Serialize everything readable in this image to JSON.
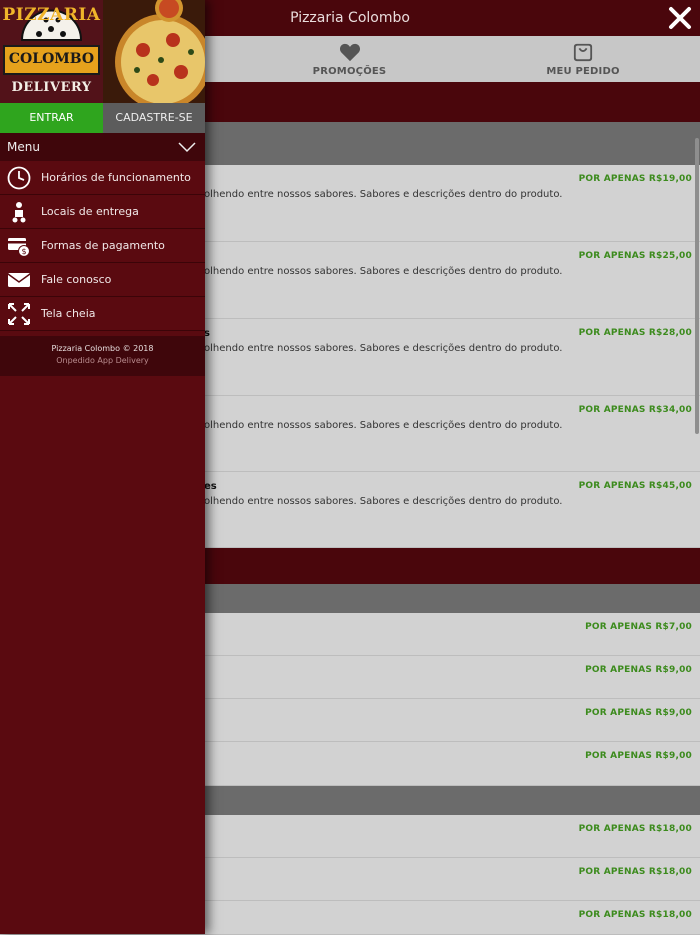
{
  "app": {
    "title": "Pizzaria Colombo"
  },
  "tabs": [
    {
      "label": "PROMOÇÕES",
      "icon": "heart-icon"
    },
    {
      "label": "MEU PEDIDO",
      "icon": "bag-icon"
    }
  ],
  "sections": [
    {
      "rows": [
        {
          "name": "",
          "desc": "olhendo entre nossos sabores. Sabores e descrições dentro do produto.",
          "price": "POR APENAS R$19,00"
        },
        {
          "name": "",
          "desc": "olhendo entre nossos sabores. Sabores e descrições dentro do produto.",
          "price": "POR APENAS R$25,00"
        },
        {
          "name": "s",
          "desc": "olhendo entre nossos sabores. Sabores e descrições dentro do produto.",
          "price": "POR APENAS R$28,00"
        },
        {
          "name": "",
          "desc": "olhendo entre nossos sabores. Sabores e descrições dentro do produto.",
          "price": "POR APENAS R$34,00"
        },
        {
          "name": "es",
          "desc": "olhendo entre nossos sabores. Sabores e descrições dentro do produto.",
          "price": "POR APENAS R$45,00"
        }
      ]
    },
    {
      "rows": [
        {
          "price": "POR APENAS R$7,00"
        },
        {
          "price": "POR APENAS R$9,00"
        },
        {
          "price": "POR APENAS R$9,00"
        },
        {
          "price": "POR APENAS R$9,00"
        }
      ]
    },
    {
      "rows": [
        {
          "price": "POR APENAS R$18,00"
        },
        {
          "price": "POR APENAS R$18,00"
        },
        {
          "price": "POR APENAS R$18,00"
        }
      ]
    }
  ],
  "drawer": {
    "logo": {
      "line1": "PIZZARIA",
      "line2": "COLOMBO",
      "line3": "DELIVERY"
    },
    "login_label": "ENTRAR",
    "register_label": "CADASTRE-SE",
    "menu_title": "Menu",
    "items": [
      {
        "label": "Horários de funcionamento",
        "icon": "clock-icon"
      },
      {
        "label": "Locais de entrega",
        "icon": "scooter-icon"
      },
      {
        "label": "Formas de pagamento",
        "icon": "payment-icon"
      },
      {
        "label": "Fale conosco",
        "icon": "mail-icon"
      },
      {
        "label": "Tela cheia",
        "icon": "fullscreen-icon"
      }
    ],
    "copyright": "Pizzaria Colombo © 2018",
    "powered_by": "Onpedido App Delivery"
  },
  "colors": {
    "brand_dark": "#4a060c",
    "drawer_bg": "#5a0a10",
    "login_green": "#2fa51e",
    "price_green": "#3c8b1d"
  }
}
